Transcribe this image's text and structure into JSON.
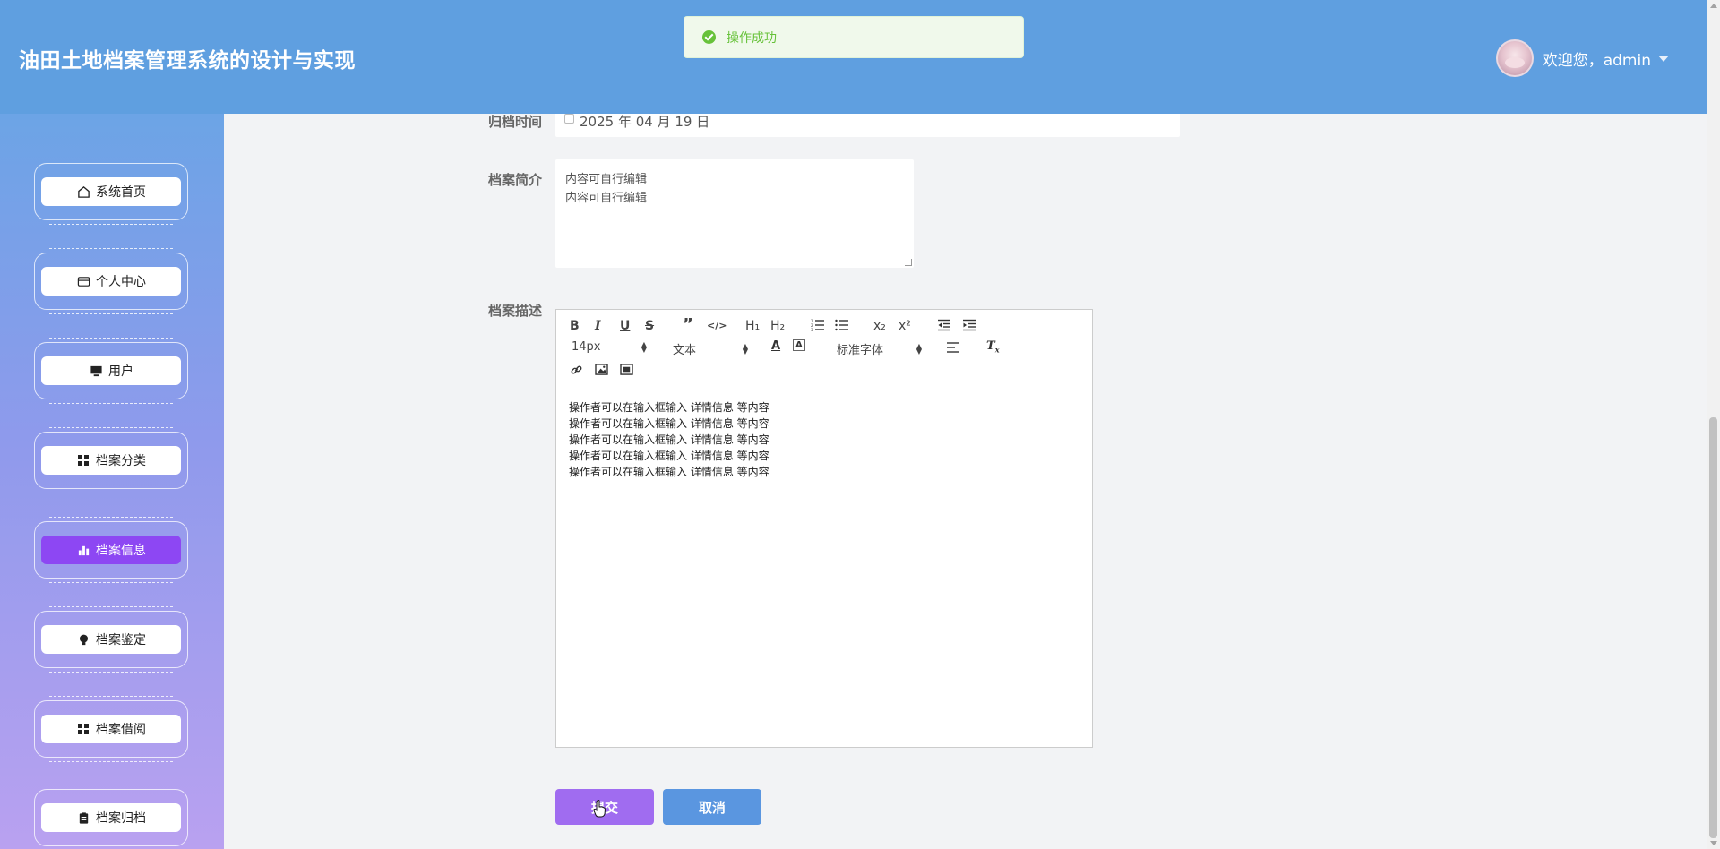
{
  "header": {
    "title": "油田土地档案管理系统的设计与实现",
    "welcome": "欢迎您，admin"
  },
  "toast": {
    "message": "操作成功",
    "type": "success"
  },
  "sidebar": {
    "items": [
      {
        "label": "系统首页",
        "icon": "home-icon",
        "active": false
      },
      {
        "label": "个人中心",
        "icon": "card-icon",
        "active": false
      },
      {
        "label": "用户",
        "icon": "monitor-icon",
        "active": false
      },
      {
        "label": "档案分类",
        "icon": "grid-icon",
        "active": false
      },
      {
        "label": "档案信息",
        "icon": "bar-chart-icon",
        "active": true
      },
      {
        "label": "档案鉴定",
        "icon": "bulb-icon",
        "active": false
      },
      {
        "label": "档案借阅",
        "icon": "grid-icon",
        "active": false
      },
      {
        "label": "档案归档",
        "icon": "clipboard-icon",
        "active": false
      }
    ]
  },
  "form": {
    "archive_time": {
      "label": "归档时间",
      "value": "2025 年 04 月 19 日"
    },
    "summary": {
      "label": "档案简介",
      "lines": [
        "内容可自行编辑",
        "内容可自行编辑"
      ]
    },
    "description": {
      "label": "档案描述",
      "toolbar": {
        "font_size": "14px",
        "header_type": "文本",
        "font_family": "标准字体",
        "subscript": "x₂",
        "superscript": "x²",
        "h1": "H₁",
        "h2": "H₂"
      },
      "lines": [
        "操作者可以在输入框输入  详情信息  等内容",
        "操作者可以在输入框输入  详情信息  等内容",
        "操作者可以在输入框输入  详情信息  等内容",
        "操作者可以在输入框输入  详情信息  等内容",
        "操作者可以在输入框输入  详情信息  等内容"
      ]
    },
    "submit_label": "提交",
    "cancel_label": "取消"
  },
  "colors": {
    "header_bg": "#5f9fe0",
    "active_nav": "#8d47f3",
    "submit_button": "#a06cf0",
    "cancel_button": "#5a96e0",
    "toast_text": "#67c23a"
  }
}
